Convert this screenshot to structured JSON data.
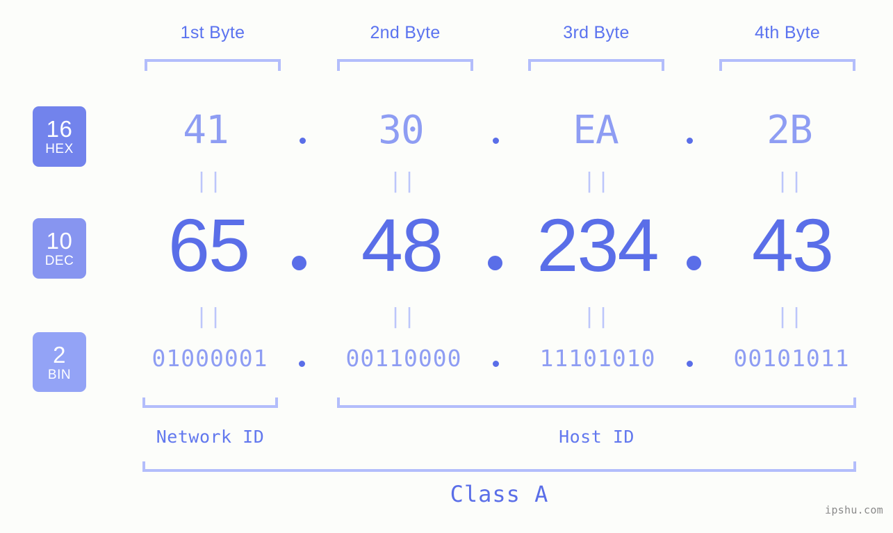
{
  "page": {
    "background_color": "#fcfdfa",
    "accent_color": "#5a6ee8",
    "accent_light_color": "#b3bdfb",
    "watermark": "ipshu.com"
  },
  "byte_headers": [
    {
      "label": "1st Byte"
    },
    {
      "label": "2nd Byte"
    },
    {
      "label": "3rd Byte"
    },
    {
      "label": "4th Byte"
    }
  ],
  "rows": {
    "hex": {
      "badge_number": "16",
      "badge_name": "HEX",
      "badge_color": "#7283ec",
      "values": [
        "41",
        "30",
        "EA",
        "2B"
      ],
      "separator": "."
    },
    "dec": {
      "badge_number": "10",
      "badge_name": "DEC",
      "badge_color": "#8795f0",
      "values": [
        "65",
        "48",
        "234",
        "43"
      ],
      "separator": "."
    },
    "bin": {
      "badge_number": "2",
      "badge_name": "BIN",
      "badge_color": "#93a3f6",
      "values": [
        "01000001",
        "00110000",
        "11101010",
        "00101011"
      ],
      "separator": "."
    }
  },
  "equals_marks": {
    "glyph": "||"
  },
  "sections": {
    "network_id": "Network ID",
    "host_id": "Host ID",
    "class": "Class A"
  }
}
